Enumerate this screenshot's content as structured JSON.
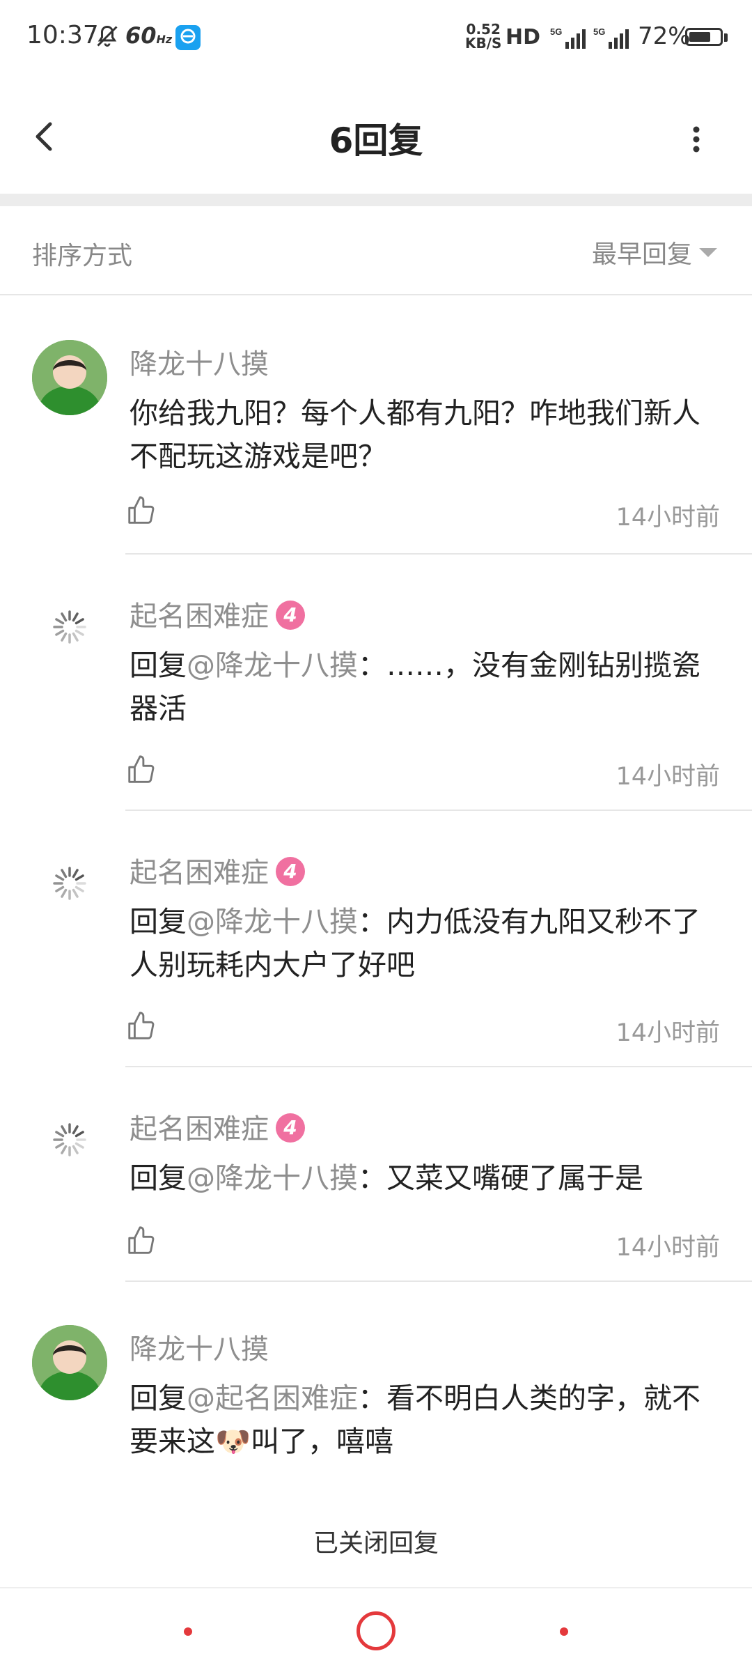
{
  "status_bar": {
    "time": "10:37",
    "refresh_rate": "60",
    "refresh_unit": "Hz",
    "net_speed_value": "0.52",
    "net_speed_unit": "KB/S",
    "hd_label": "HD",
    "signal_label": "5G",
    "battery_text": "72%",
    "battery_level": 0.72
  },
  "header": {
    "title": "6回复",
    "back_icon": "chevron-left-icon",
    "more_icon": "more-vertical-icon"
  },
  "sort": {
    "label": "排序方式",
    "selected": "最早回复"
  },
  "comments": [
    {
      "author": "降龙十八摸",
      "avatar": "photo",
      "badge": "",
      "prefix": "",
      "mention": "",
      "separator": "",
      "body": "你给我九阳？每个人都有九阳？咋地我们新人不配玩这游戏是吧？",
      "time": "14小时前"
    },
    {
      "author": "起名困难症",
      "avatar": "loading",
      "badge": "4",
      "prefix": "回复",
      "mention": "@降龙十八摸",
      "separator": "：",
      "body": "……，没有金刚钻别揽瓷器活",
      "time": "14小时前"
    },
    {
      "author": "起名困难症",
      "avatar": "loading",
      "badge": "4",
      "prefix": "回复",
      "mention": "@降龙十八摸",
      "separator": "：",
      "body": "内力低没有九阳又秒不了人别玩耗内大户了好吧",
      "time": "14小时前"
    },
    {
      "author": "起名困难症",
      "avatar": "loading",
      "badge": "4",
      "prefix": "回复",
      "mention": "@降龙十八摸",
      "separator": "：",
      "body": "又菜又嘴硬了属于是",
      "time": "14小时前"
    },
    {
      "author": "降龙十八摸",
      "avatar": "photo",
      "badge": "",
      "prefix": "回复",
      "mention": "@起名困难症",
      "separator": "：",
      "body_before_emoji": "看不明白人类的字，就不要来这",
      "emoji": "🐶",
      "body_after_emoji": "叫了，嘻嘻",
      "time": ""
    }
  ],
  "footer": {
    "closed_notice": "已关闭回复"
  },
  "colors": {
    "accent": "#e4393c",
    "badge": "#f070a0",
    "muted": "#8e8e8e"
  }
}
